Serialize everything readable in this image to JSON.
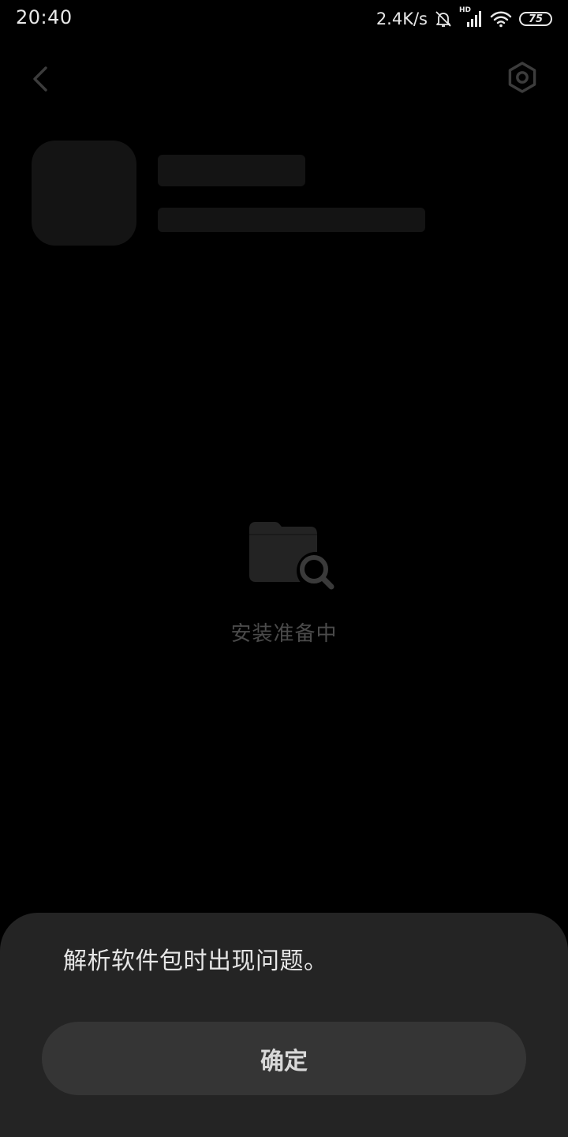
{
  "status_bar": {
    "time": "20:40",
    "net_speed": "2.4K/s",
    "network_badge": "HD",
    "battery_level": "75",
    "icons": [
      "bell-off-icon",
      "signal-icon",
      "wifi-icon",
      "battery-icon"
    ]
  },
  "top_bar": {
    "back_icon": "chevron-left-icon",
    "settings_icon": "hexagon-gear-icon"
  },
  "main": {
    "loading_icon": "folder-search-icon",
    "loading_text": "安装准备中"
  },
  "dialog": {
    "message": "解析软件包时出现问题。",
    "confirm_label": "确定"
  },
  "colors": {
    "background": "#000000",
    "placeholder": "#141414",
    "dialog_background": "#242424",
    "button_background": "#353535",
    "loading_text": "#4a4a4a",
    "icon_muted": "#3a3a3a"
  }
}
